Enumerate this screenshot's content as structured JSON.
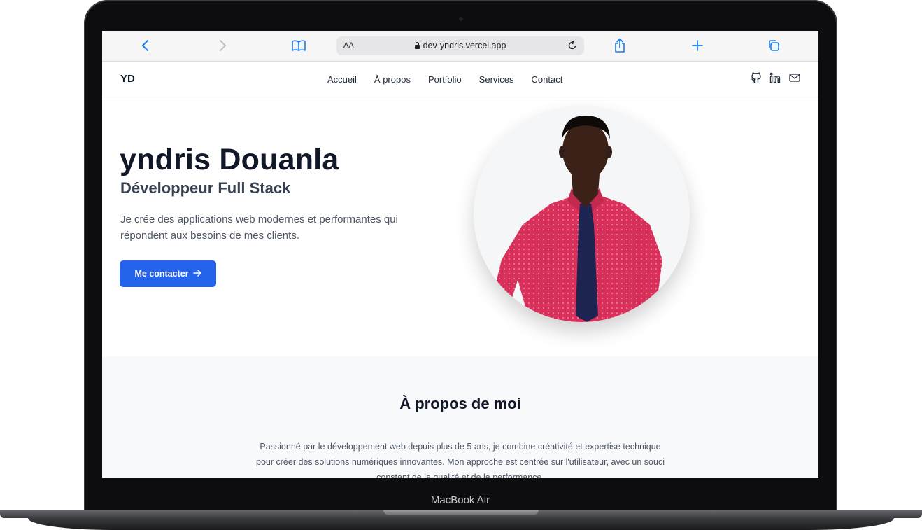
{
  "device": {
    "label": "MacBook Air"
  },
  "browser": {
    "text_size_label": "AA",
    "url": "dev-yndris.vercel.app",
    "icons": [
      "back-icon",
      "forward-icon",
      "bookmarks-icon",
      "lock-icon",
      "reload-icon",
      "share-icon",
      "new-tab-icon",
      "tabs-icon"
    ]
  },
  "site": {
    "logo": "YD",
    "nav": [
      "Accueil",
      "À propos",
      "Portfolio",
      "Services",
      "Contact"
    ],
    "social_icons": [
      "github-icon",
      "linkedin-icon",
      "mail-icon"
    ]
  },
  "hero": {
    "name": "yndris Douanla",
    "role": "Développeur Full Stack",
    "description": "Je crée des applications web modernes et performantes qui répondent aux besoins de mes clients.",
    "cta_label": "Me contacter",
    "cta_icon": "arrow-right-icon"
  },
  "about": {
    "title": "À propos de moi",
    "text": "Passionné par le développement web depuis plus de 5 ans, je combine créativité et expertise technique pour créer des solutions numériques innovantes. Mon approche est centrée sur l'utilisateur, avec un souci constant de la qualité et de la performance."
  },
  "colors": {
    "accent": "#2563eb",
    "heading": "#111827",
    "shirt": "#d8305a",
    "tie": "#1d2451"
  }
}
